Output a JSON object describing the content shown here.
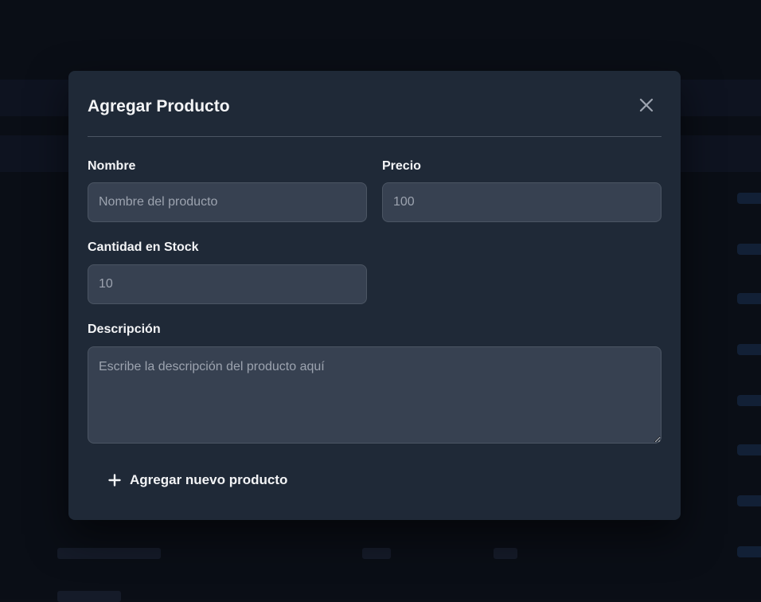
{
  "modal": {
    "title": "Agregar Producto",
    "close_icon": "close-icon",
    "fields": {
      "name": {
        "label": "Nombre",
        "placeholder": "Nombre del producto",
        "value": ""
      },
      "price": {
        "label": "Precio",
        "placeholder": "100",
        "value": ""
      },
      "stock": {
        "label": "Cantidad en Stock",
        "placeholder": "10",
        "value": ""
      },
      "description": {
        "label": "Descripción",
        "placeholder": "Escribe la descripción del producto aquí",
        "value": ""
      }
    },
    "submit": {
      "icon": "plus-icon",
      "label": "Agregar nuevo producto"
    }
  },
  "colors": {
    "overlay": "#0a0e16",
    "modal_bg": "#1f2937",
    "input_bg": "#374151",
    "input_border": "#4b5563",
    "text": "#f3f4f6",
    "placeholder": "#9ca3af"
  }
}
